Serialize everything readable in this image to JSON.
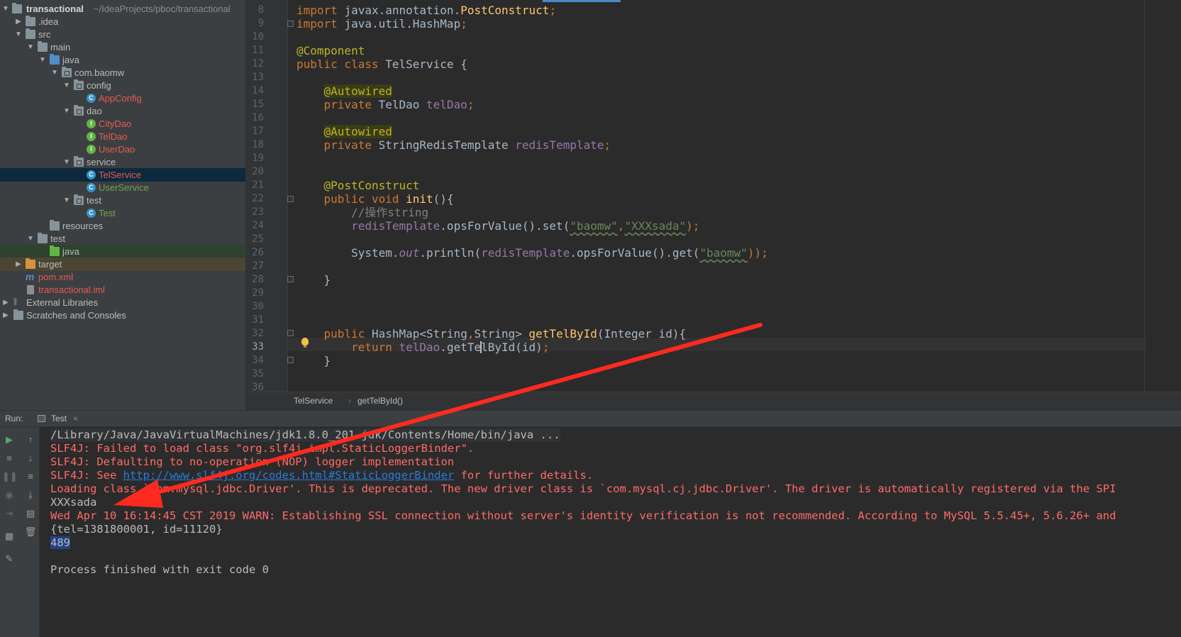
{
  "project_tree": {
    "root_name": "transactional",
    "root_path": "~/IdeaProjects/pboc/transactional",
    "items": [
      {
        "label": ".idea"
      },
      {
        "label": "src"
      },
      {
        "label": "main"
      },
      {
        "label": "java"
      },
      {
        "label": "com.baomw"
      },
      {
        "label": "config"
      },
      {
        "label": "AppConfig"
      },
      {
        "label": "dao"
      },
      {
        "label": "CityDao"
      },
      {
        "label": "TelDao"
      },
      {
        "label": "UserDao"
      },
      {
        "label": "service"
      },
      {
        "label": "TelService"
      },
      {
        "label": "UserService"
      },
      {
        "label": "test"
      },
      {
        "label": "Test"
      },
      {
        "label": "resources"
      },
      {
        "label": "test"
      },
      {
        "label": "java"
      },
      {
        "label": "target"
      },
      {
        "label": "pom.xml"
      },
      {
        "label": "transactional.iml"
      },
      {
        "label": "External Libraries"
      },
      {
        "label": "Scratches and Consoles"
      }
    ]
  },
  "editor": {
    "line_numbers": [
      "8",
      "9",
      "10",
      "11",
      "12",
      "13",
      "14",
      "15",
      "16",
      "17",
      "18",
      "19",
      "20",
      "21",
      "22",
      "23",
      "24",
      "25",
      "26",
      "27",
      "28",
      "29",
      "30",
      "31",
      "32",
      "33",
      "34",
      "35",
      "36"
    ],
    "current_line": "33",
    "tokens": {
      "kw_import": "import",
      "postconstruct_import": "javax.annotation.",
      "postconstruct_cls": "PostConstruct",
      "hashmap_import": "java.util.HashMap",
      "semi": ";",
      "component": "@Component",
      "public_class": "public class",
      "class_decl": " TelService {",
      "autowired": "@Autowired",
      "private": "private",
      "teldao_type": " TelDao ",
      "teldao_field": "telDao",
      "redis_type": " StringRedisTemplate ",
      "redis_field": "redisTemplate",
      "postconstruct_ann": "@PostConstruct",
      "public_void": "public void",
      "init_name": "init",
      "init_tail": "(){",
      "comment": "//操作string",
      "redis_call1": ".opsForValue().set(",
      "key1": "\"baomw\"",
      "comma": ",",
      "val1": "\"XXXsada\"",
      "close_semi": ");",
      "system": "System.",
      "out": "out",
      "println": ".println(",
      "redis_call2": ".opsForValue().get(",
      "key2": "\"baomw\"",
      "close2": "));",
      "brace_close": "}",
      "public": "public",
      "hashmap_sig": " HashMap<String",
      "hashmap_sig2": "String> ",
      "gettel_name": "getTelById",
      "gettel_args": "(Integer id){",
      "return": "return",
      "dot": ".",
      "gettel_call_a": "getTe",
      "gettel_call_b": "lById",
      "gettel_call_tail": "(id)"
    }
  },
  "breadcrumb": {
    "items": [
      "TelService",
      "getTelById()"
    ]
  },
  "run_panel": {
    "run_label": "Run:",
    "tab_label": "Test",
    "tab_close": "×",
    "console_lines": [
      "/Library/Java/JavaVirtualMachines/jdk1.8.0_201.jdk/Contents/Home/bin/java ...",
      "SLF4J: Failed to load class \"org.slf4j.impl.StaticLoggerBinder\".",
      "SLF4J: Defaulting to no-operation (NOP) logger implementation",
      "SLF4J: See ",
      "Loading class `com.mysql.jdbc.Driver'. This is deprecated. The new driver class is `com.mysql.cj.jdbc.Driver'. The driver is automatically registered via the SPI",
      "XXXsada",
      "Wed Apr 10 16:14:45 CST 2019 WARN: Establishing SSL connection without server's identity verification is not recommended. According to MySQL 5.5.45+, 5.6.26+ and",
      "{tel=1381800001, id=11120}",
      "489",
      "",
      "Process finished with exit code 0"
    ],
    "slf4j_link": "http://www.slf4j.org/codes.html#StaticLoggerBinder",
    "slf4j_tail": " for further details."
  },
  "colors": {
    "annotation_arrow": "#ff2a1f",
    "error_text": "#ff6b68",
    "link": "#287bde"
  }
}
